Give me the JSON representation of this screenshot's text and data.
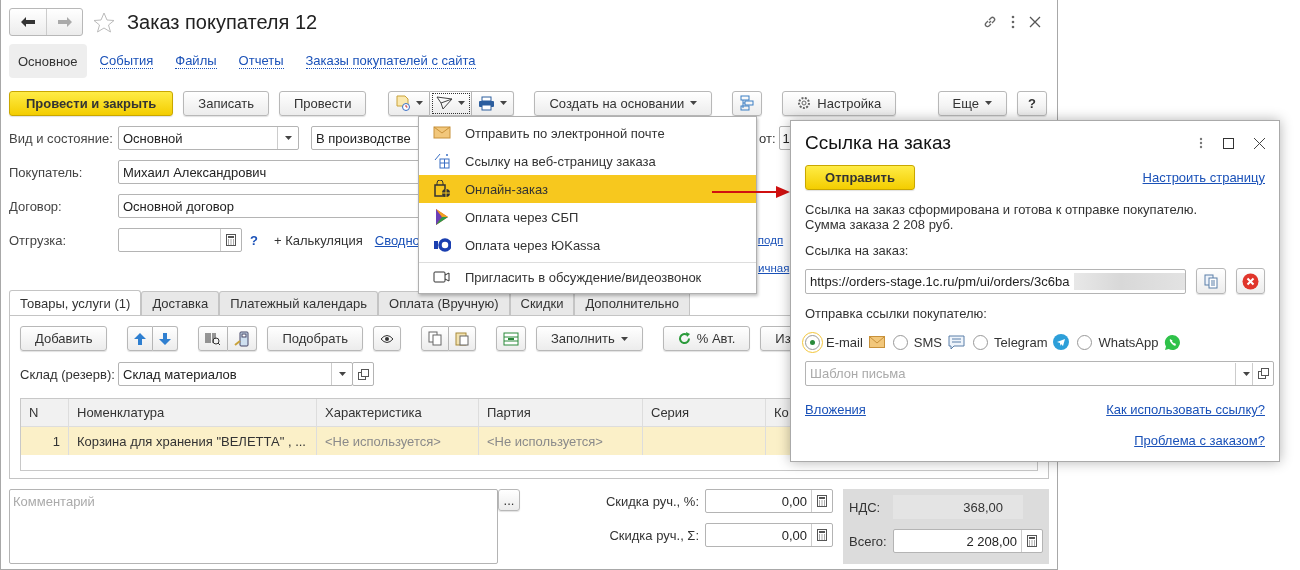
{
  "window": {
    "title": "Заказ покупателя 12"
  },
  "nav_tabs": [
    {
      "label": "Основное",
      "selected": true
    },
    {
      "label": "События",
      "selected": false
    },
    {
      "label": "Файлы",
      "selected": false
    },
    {
      "label": "Отчеты",
      "selected": false
    },
    {
      "label": "Заказы покупателей с сайта",
      "selected": false
    }
  ],
  "toolbar": [
    {
      "kind": "primary",
      "label": "Провести и закрыть"
    },
    {
      "kind": "button",
      "label": "Записать"
    },
    {
      "kind": "button",
      "label": "Провести"
    },
    {
      "kind": "menu-group",
      "items": [
        {
          "open": false
        },
        {
          "open": true
        },
        {
          "open": false
        }
      ]
    },
    {
      "kind": "dropdown",
      "label": "Создать на основании"
    },
    {
      "kind": "structure"
    },
    {
      "kind": "settings",
      "label": "Настройка"
    },
    {
      "kind": "more",
      "label": "Еще"
    },
    {
      "kind": "help",
      "label": "?"
    }
  ],
  "form": {
    "state_label": "Вид и состояние:",
    "kind_value": "Основной",
    "state_value": "В производстве",
    "date_label": "от:",
    "date_value": "1",
    "customer_label": "Покупатель:",
    "customer": "Михаил Александрович",
    "contract_label": "Договор:",
    "contract": "Основной договор",
    "shipment_label": "Отгрузка:",
    "help": "?",
    "calc": "+ Калькуляция",
    "summary_link": "Сводно",
    "side_links": [
      "подп",
      "ичная"
    ]
  },
  "menu": {
    "items": [
      {
        "label": "Отправить по электронной почте",
        "selected": false,
        "separator_before": false
      },
      {
        "label": "Ссылку на веб-страницу заказа",
        "selected": false,
        "separator_before": false
      },
      {
        "label": "Онлайн-заказ",
        "selected": true,
        "separator_before": false
      },
      {
        "label": "Оплата через СБП",
        "selected": false,
        "separator_before": false
      },
      {
        "label": "Оплата через ЮKassa",
        "selected": false,
        "separator_before": false
      },
      {
        "label": "Пригласить в обсуждение/видеозвонок",
        "selected": false,
        "separator_before": true
      }
    ]
  },
  "dialog": {
    "title": "Ссылка на заказ",
    "send": "Отправить",
    "setup_link": "Настроить страницу",
    "message": [
      "Ссылка на заказ сформирована и готова к отправке покупателю.",
      "Сумма заказа 2 208 руб."
    ],
    "link_label": "Ссылка на заказ:",
    "link_value": "https://orders-stage.1c.ru/pm/ui/orders/3c6ba",
    "send_label": "Отправка ссылки покупателю:",
    "channels": [
      {
        "label": "E-mail",
        "selected": true
      },
      {
        "label": "SMS",
        "selected": false
      },
      {
        "label": "Telegram",
        "selected": false
      },
      {
        "label": "WhatsApp",
        "selected": false
      }
    ],
    "template_placeholder": "Шаблон письма",
    "attachments_link": "Вложения",
    "howto_link": "Как использовать ссылку?",
    "problem_link": "Проблема с заказом?"
  },
  "tabs": [
    {
      "label": "Товары, услуги (1)",
      "selected": true
    },
    {
      "label": "Доставка",
      "selected": false
    },
    {
      "label": "Платежный календарь",
      "selected": false
    },
    {
      "label": "Оплата (Вручную)",
      "selected": false
    },
    {
      "label": "Скидки",
      "selected": false
    },
    {
      "label": "Дополнительно",
      "selected": false
    }
  ],
  "table_toolbar": [
    {
      "kind": "button",
      "label": "Добавить"
    },
    {
      "kind": "arrows"
    },
    {
      "kind": "scan"
    },
    {
      "kind": "button",
      "label": "Подобрать"
    },
    {
      "kind": "eye"
    },
    {
      "kind": "copy-paste"
    },
    {
      "kind": "grid"
    },
    {
      "kind": "dropdown",
      "label": "Заполнить"
    },
    {
      "kind": "refresh",
      "label": "% Авт."
    },
    {
      "kind": "button",
      "label": "Из"
    }
  ],
  "warehouse": {
    "label": "Склад (резерв):",
    "value": "Склад материалов"
  },
  "table": {
    "columns": [
      "N",
      "Номенклатура",
      "Характеристика",
      "Партия",
      "Серия",
      "Ко"
    ],
    "rows": [
      {
        "selected": true,
        "cells": [
          {
            "text": "1",
            "muted": false
          },
          {
            "text": "Корзина для хранения \"ВЕЛЕТТА\" , ...",
            "muted": false
          },
          {
            "text": "<Не используется>",
            "muted": true
          },
          {
            "text": "<Не используется>",
            "muted": true
          }
        ]
      }
    ]
  },
  "comment": {
    "placeholder": "Комментарий",
    "button": "..."
  },
  "discounts": [
    {
      "label": "Скидка руч., %:",
      "value": "0,00"
    },
    {
      "label": "Скидка руч., Σ:",
      "value": "0,00"
    }
  ],
  "totals": {
    "vat_label": "НДС:",
    "vat": "368,00",
    "total_label": "Всего:",
    "total": "2 208,00"
  }
}
